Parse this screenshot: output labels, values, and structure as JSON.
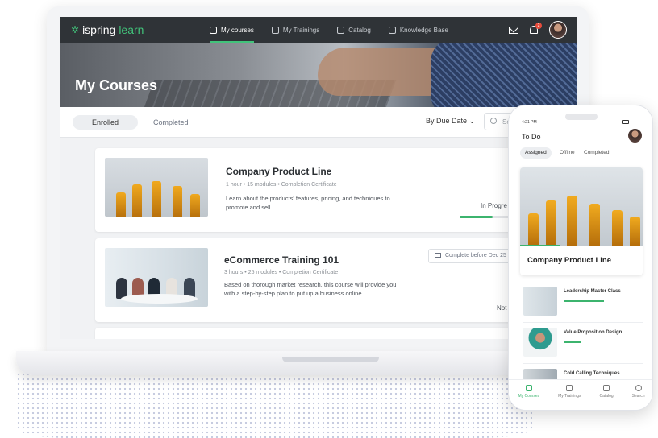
{
  "app": {
    "logo_text": "ispring",
    "logo_accent": "learn",
    "accent_color": "#41c37a"
  },
  "topnav": {
    "items": [
      {
        "label": "My courses",
        "active": true,
        "icon": "book-icon"
      },
      {
        "label": "My Trainings",
        "active": false,
        "icon": "calendar-icon"
      },
      {
        "label": "Catalog",
        "active": false,
        "icon": "catalog-icon"
      },
      {
        "label": "Knowledge Base",
        "active": false,
        "icon": "knowledge-icon"
      }
    ],
    "notification_count": "2"
  },
  "hero": {
    "title": "My Courses"
  },
  "tabs": {
    "enrolled": "Enrolled",
    "completed": "Completed"
  },
  "sort": {
    "label": "By Due Date"
  },
  "search": {
    "placeholder": "Se"
  },
  "courses": [
    {
      "title": "Company Product Line",
      "duration": "1 hour",
      "modules": "15 modules",
      "certificate": "Completion Certificate",
      "description": "Learn about the products' features, pricing, and techniques to promote and sell.",
      "status": "In Progre",
      "progress": 0.6
    },
    {
      "title": "eCommerce Training 101",
      "duration": "3 hours",
      "modules": "25 modules",
      "certificate": "Completion Certificate",
      "description": "Based on thorough market research, this course will provide you with a step-by-step plan to put up a business online.",
      "deadline": "Complete before Dec 25",
      "status": "Not"
    }
  ],
  "phone": {
    "time": "4:21 PM",
    "title": "To Do",
    "tabs": [
      "Assigned",
      "Offline",
      "Completed"
    ],
    "featured": {
      "title": "Company Product Line",
      "progress": 0.33
    },
    "items": [
      {
        "name": "Leadership Master Class",
        "progress": 0.7
      },
      {
        "name": "Value Proposition Design",
        "progress": 0.3
      },
      {
        "name": "Cold Calling Techniques",
        "progress": 0.0
      }
    ],
    "nav": [
      "My Courses",
      "My Trainings",
      "Catalog",
      "Search"
    ]
  }
}
